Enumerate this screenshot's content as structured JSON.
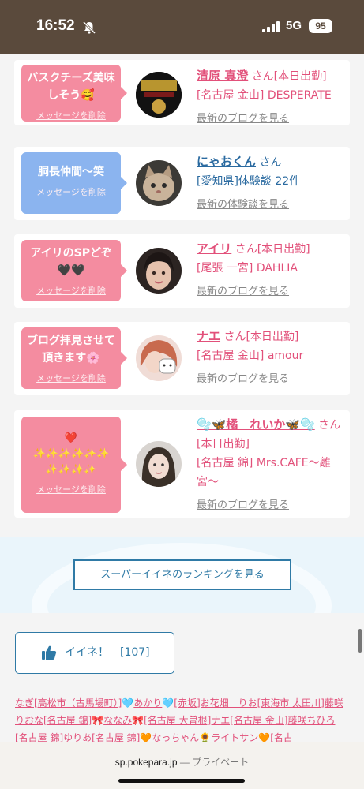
{
  "status": {
    "time": "16:52",
    "network": "5G",
    "battery": "95"
  },
  "cards": [
    {
      "bubble_color": "pink",
      "message": "バスクチーズ美味しそう🥰",
      "delete_label": "メッセージを削除",
      "name": "清原 真澄",
      "suffix": "さん[本日出勤]",
      "details": [
        "[名古屋 金山] DESPERATE"
      ],
      "more_link": "最新のブログを見る",
      "theme": "pink"
    },
    {
      "bubble_color": "blue",
      "message": "胴長仲間〜笑",
      "delete_label": "メッセージを削除",
      "name": "にゃおくん",
      "suffix": "さん",
      "details": [
        "[愛知県]体験談 22件"
      ],
      "more_link": "最新の体験談を見る",
      "theme": "blue"
    },
    {
      "bubble_color": "pink",
      "message": "アイリのSPどぞ🖤🖤",
      "delete_label": "メッセージを削除",
      "name": "アイリ",
      "suffix": "さん[本日出勤]",
      "details": [
        "[尾張 一宮] DAHLIA"
      ],
      "more_link": "最新のブログを見る",
      "theme": "pink"
    },
    {
      "bubble_color": "pink",
      "message": "ブログ拝見させて頂きます🌸",
      "delete_label": "メッセージを削除",
      "name": "ナエ",
      "suffix": "さん[本日出勤]",
      "details": [
        "[名古屋 金山] amour"
      ],
      "more_link": "最新のブログを見る",
      "theme": "pink"
    },
    {
      "bubble_color": "pink",
      "message": "❤️ ✨✨✨✨✨✨ ✨✨✨✨",
      "delete_label": "メッセージを削除",
      "name": "🫧🦋橘　れいか🦋🫧",
      "suffix": "さん[本日出勤]",
      "details": [
        "[名古屋 錦] Mrs.CAFE〜離宮〜"
      ],
      "more_link": "最新のブログを見る",
      "theme": "pink"
    }
  ],
  "ranking_button": "スーパーイイネのランキングを見る",
  "like_button": {
    "label": "イイネ！",
    "count": "[107]"
  },
  "likers": [
    "なぎ[高松市（古馬場町）]",
    "🩵",
    "あかり",
    "🩵",
    "[赤坂]お花畑　りお[東海市 太田川]",
    "藤咲 りおな[名古屋 錦]",
    "🎀",
    "ななみ",
    "🎀",
    "[名古屋 大曽根]ナエ[名古屋 金山]藤咲",
    "ちひろ[名古屋 錦]ゆりあ[名古屋 錦]",
    "🧡",
    "なっちゃん",
    "🌻",
    "ライトサン",
    "🧡",
    "[名古"
  ],
  "safari": {
    "domain": "sp.pokepara.jp",
    "separator": "—",
    "mode": "プライベート"
  }
}
